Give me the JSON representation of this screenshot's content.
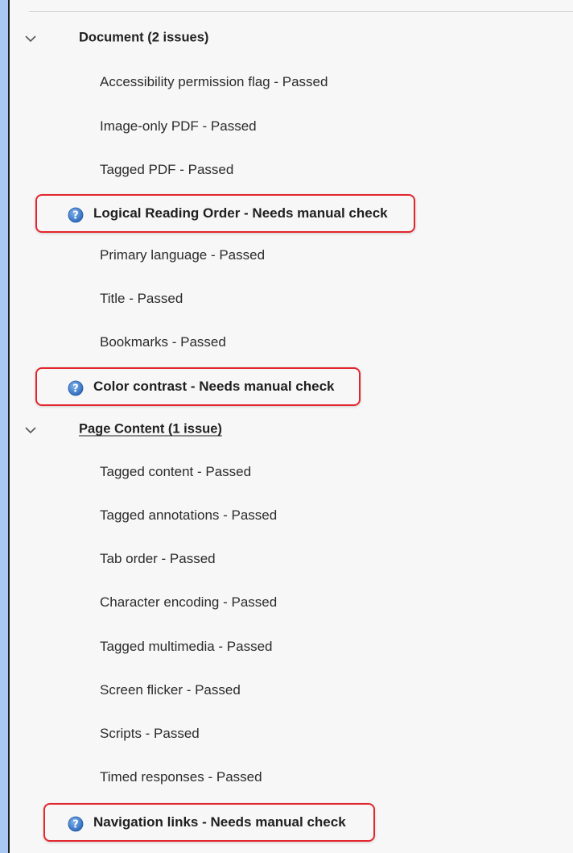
{
  "groups": [
    {
      "label": "Document (2 issues)",
      "items": [
        {
          "label": "Accessibility permission flag - Passed",
          "status": "passed"
        },
        {
          "label": "Image-only PDF - Passed",
          "status": "passed"
        },
        {
          "label": "Tagged PDF - Passed",
          "status": "passed"
        },
        {
          "label": "Logical Reading Order - Needs manual check",
          "status": "manual"
        },
        {
          "label": "Primary language - Passed",
          "status": "passed"
        },
        {
          "label": "Title - Passed",
          "status": "passed"
        },
        {
          "label": "Bookmarks - Passed",
          "status": "passed"
        },
        {
          "label": "Color contrast - Needs manual check",
          "status": "manual"
        }
      ]
    },
    {
      "label": "Page Content (1 issue)",
      "items": [
        {
          "label": "Tagged content - Passed",
          "status": "passed"
        },
        {
          "label": "Tagged annotations - Passed",
          "status": "passed"
        },
        {
          "label": "Tab order - Passed",
          "status": "passed"
        },
        {
          "label": "Character encoding - Passed",
          "status": "passed"
        },
        {
          "label": "Tagged multimedia - Passed",
          "status": "passed"
        },
        {
          "label": "Screen flicker - Passed",
          "status": "passed"
        },
        {
          "label": "Scripts - Passed",
          "status": "passed"
        },
        {
          "label": "Timed responses - Passed",
          "status": "passed"
        },
        {
          "label": "Navigation links - Needs manual check",
          "status": "manual"
        }
      ]
    }
  ],
  "colors": {
    "highlight_border": "#e3262e",
    "question_icon": "#2f74c9"
  },
  "icons": {
    "expand": "chevron-down-icon",
    "manual_check": "question-mark-icon"
  }
}
